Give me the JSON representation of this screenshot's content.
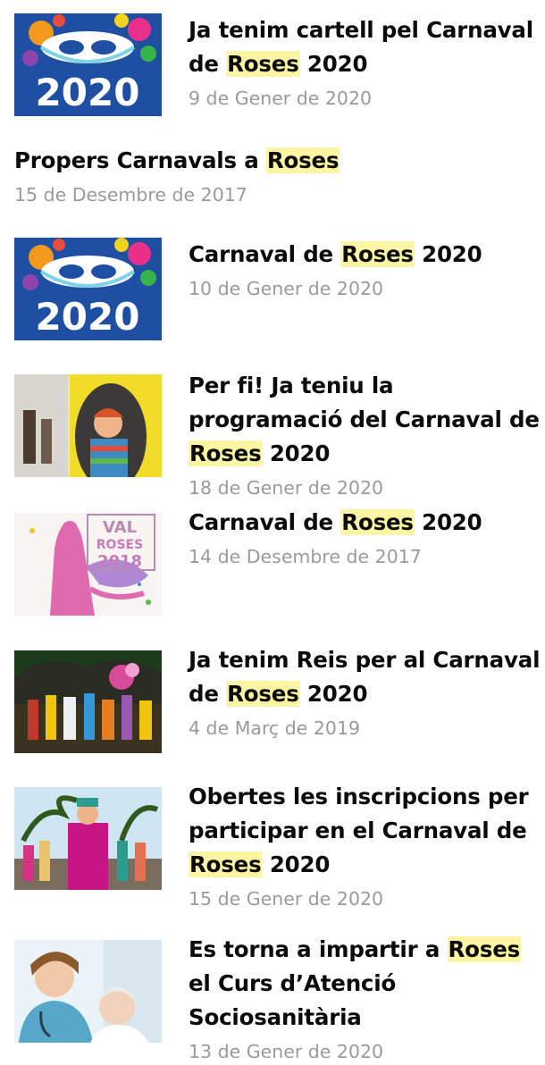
{
  "highlight_color": "#fbf5a4",
  "results": [
    {
      "title_pre": "Ja tenim cartell pel Carnaval de ",
      "keyword": "Roses",
      "title_post": " 2020",
      "date": "9 de Gener de 2020",
      "thumb": "carnival-mask-2020-poster"
    },
    {
      "title_pre": "Propers Carnavals a ",
      "keyword": "Roses",
      "title_post": "",
      "date": "15 de Desembre de 2017",
      "thumb": ""
    },
    {
      "title_pre": "Carnaval de ",
      "keyword": "Roses",
      "title_post": " 2020",
      "date": "10 de Gener de 2020",
      "thumb": "carnival-mask-2020-poster"
    },
    {
      "title_pre": "Per fi! Ja teniu la programació del Carnaval de ",
      "keyword": "Roses",
      "title_post": " 2020",
      "date": "18 de Gener de 2020",
      "thumb": "carnival-costume-photo"
    },
    {
      "title_pre": "Carnaval de ",
      "keyword": "Roses",
      "title_post": " 2020",
      "date": "14 de Desembre de 2017",
      "thumb": "carnival-roses-2018-poster"
    },
    {
      "title_pre": "Ja tenim Reis per al Carnaval de ",
      "keyword": "Roses",
      "title_post": " 2020",
      "date": "4 de Març de 2019",
      "thumb": "carnival-parade-night-photo"
    },
    {
      "title_pre": "Obertes les inscripcions per participar en el Carnaval de ",
      "keyword": "Roses",
      "title_post": " 2020",
      "date": "15 de Gener de 2020",
      "thumb": "carnival-parade-day-photo"
    },
    {
      "title_pre": "Es torna a impartir a ",
      "keyword": "Roses",
      "title_post": " el Curs d’Atenció Sociosanitària",
      "date": "13 de Gener de 2020",
      "thumb": "nurse-elderly-photo"
    }
  ],
  "thumb_labels": {
    "poster_year": "2020",
    "roses_word": "ROSES",
    "roses_year": "2018",
    "val_word": "VAL"
  }
}
